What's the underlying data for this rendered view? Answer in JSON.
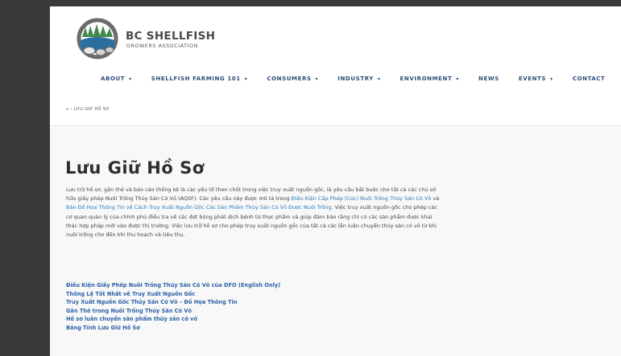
{
  "brand": {
    "title": "BC SHELLFISH",
    "subtitle": "GROWERS ASSOCIATION",
    "colors": {
      "navy": "#2c4e7a",
      "link": "#2b7ab8",
      "green": "#3f8a4a"
    }
  },
  "nav": {
    "items": [
      {
        "label": "ABOUT",
        "has_dropdown": true
      },
      {
        "label": "SHELLFISH FARMING 101",
        "has_dropdown": true
      },
      {
        "label": "CONSUMERS",
        "has_dropdown": true
      },
      {
        "label": "INDUSTRY",
        "has_dropdown": true
      },
      {
        "label": "ENVIRONMENT",
        "has_dropdown": true
      },
      {
        "label": "NEWS",
        "has_dropdown": false
      },
      {
        "label": "EVENTS",
        "has_dropdown": true
      },
      {
        "label": "CONTACT",
        "has_dropdown": false
      }
    ],
    "caret": "▾"
  },
  "breadcrumb": {
    "home_icon": "⌂",
    "separator": "›",
    "current": "LƯU GIỮ HỒ SƠ"
  },
  "page": {
    "title": "Lưu Giữ Hồ Sơ",
    "paragraph": {
      "t1": "Lưu trữ hồ sơ, gắn thẻ và báo cáo thống kê là các yếu tố then chốt trong việc truy xuất nguồn gốc, là yêu cầu bắt buộc cho tất cả các chủ sở hữu giấy phép Nuôi Trồng Thủy Sản Có Vỏ (AQSF). Các yêu cầu này được mô tả trong ",
      "l1": "Điều Kiện Cấp Phép (CoL) Nuôi Trồng Thủy Sản Có Vỏ",
      "t2": " và ",
      "l2": "Bản Đồ Họa Thông Tin về Cách Truy Xuất Nguồn Gốc Các Sản Phẩm Thủy Sản Có Vỏ Được Nuôi Trồng",
      "t3": ". Việc truy xuất nguồn gốc cho phép các cơ quan quản lý của chính phủ điều tra về các đợt bùng phát dịch bệnh từ thực phẩm và giúp đảm bảo rằng chỉ có các sản phẩm được khai thác hợp pháp mới vào được thị trường. Việc lưu trữ hồ sơ cho phép truy xuất nguồn gốc của tất cả các lần luân chuyển thủy sản có vỏ từ khi nuôi trồng cho đến khi thu hoạch và tiêu thụ."
    },
    "links": [
      "Điều Kiện Giấy Phép Nuôi Trồng Thủy Sản Có Vỏ của DFO (English Only)",
      "Thông Lệ Tốt Nhất về Truy Xuất Nguồn Gốc",
      "Truy Xuất Nguồn Gốc Thủy Sản Có Vỏ – Đồ Họa Thông Tin",
      "Gắn Thẻ trong Nuôi Trồng Thủy Sản Có Vỏ",
      "Hồ sơ luân chuyển sản phẩm thủy sản có vỏ",
      "Bảng Tính Lưu Giữ Hồ Sơ"
    ]
  }
}
